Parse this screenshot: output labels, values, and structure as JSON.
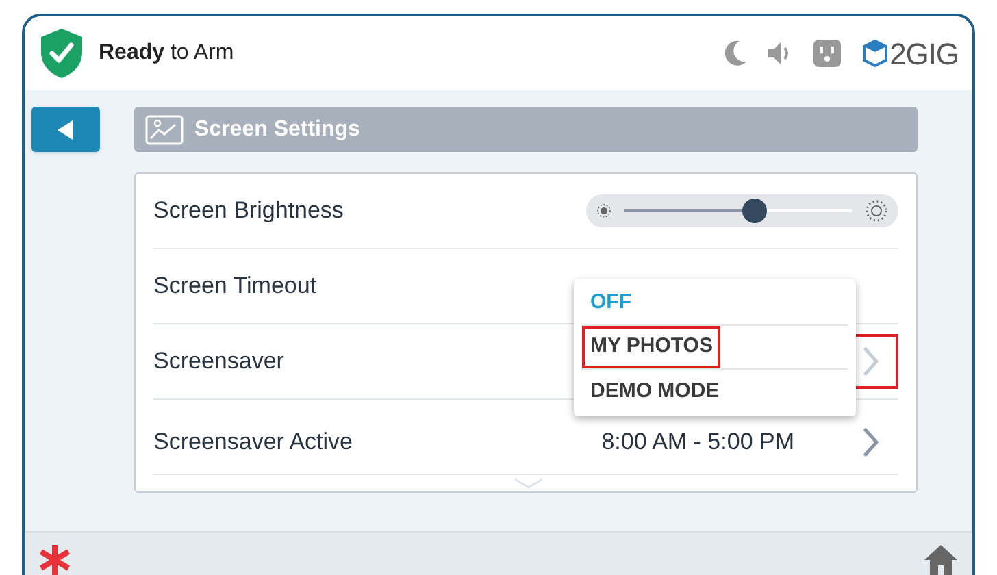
{
  "header": {
    "status": "**Ready** to Arm",
    "logo": "2GIG"
  },
  "title_bar": {
    "title": "Screen Settings"
  },
  "rows": [
    {
      "kind": "slider",
      "label": "Screen Brightness",
      "level": 0.57
    },
    {
      "kind": "plain",
      "label": "Screen Timeout"
    },
    {
      "kind": "link",
      "label": "Screensaver",
      "highlighted": true
    },
    {
      "kind": "link",
      "label": "Screensaver Active",
      "value": "8:00 AM - 5:00 PM",
      "highlighted": false
    }
  ],
  "dropdown": {
    "options": [
      {
        "label": "OFF",
        "selected": true,
        "highlighted": false
      },
      {
        "label": "MY PHOTOS",
        "selected": false,
        "highlighted": true
      },
      {
        "label": "DEMO MODE",
        "selected": false,
        "highlighted": false
      }
    ]
  }
}
